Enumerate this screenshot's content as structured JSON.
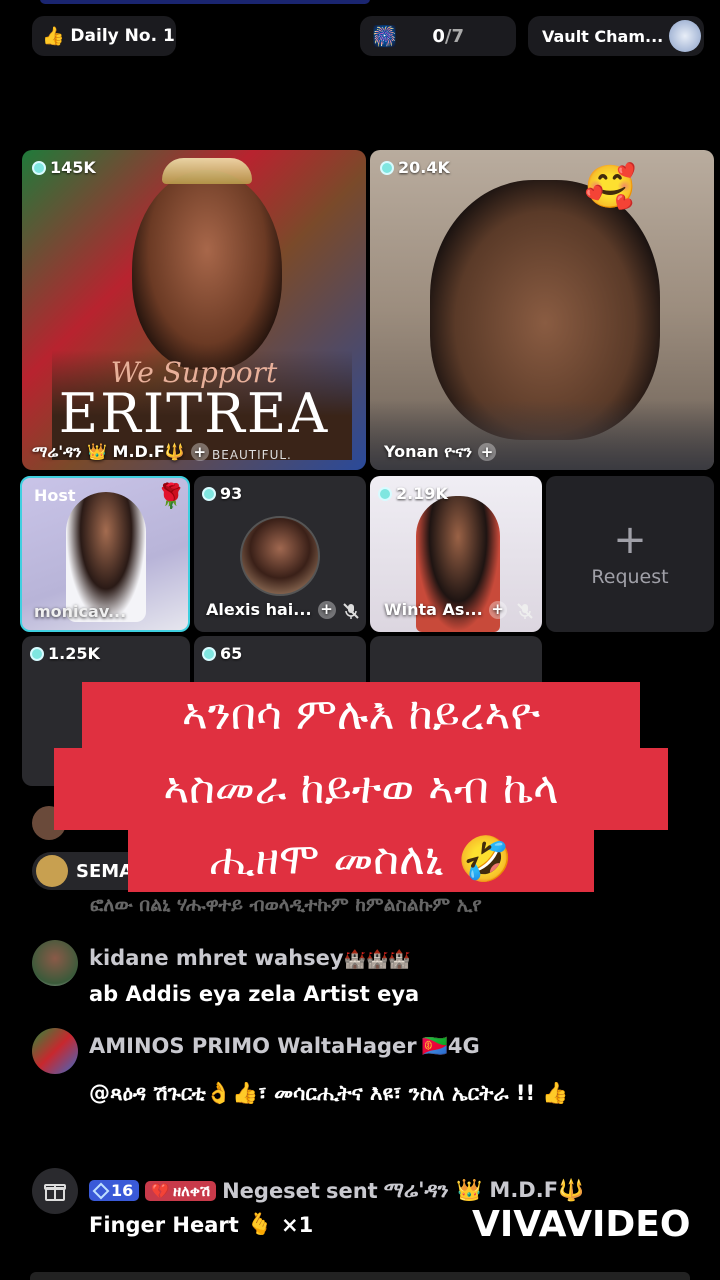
{
  "header": {
    "daily_label": "Daily No. 1",
    "daily_icon": "thumbs-up-icon",
    "counter_current": "0",
    "counter_total": "/7",
    "vault_label": "Vault Cham...",
    "vault_icon": "trophy-beast-icon"
  },
  "tiles": [
    {
      "coins": "145K",
      "name": "ማሬ'ዳን 👑 M.D.F🔱",
      "poster_script": "We Support",
      "poster_title": "ERITREA",
      "poster_sub": "BEAUTIFUL."
    },
    {
      "coins": "20.4K",
      "name": "Yonan ዮናን",
      "sticker": "heart-hug-emoji"
    },
    {
      "badge": "Host",
      "name": "monicav...",
      "sticker": "rose-icon"
    },
    {
      "coins": "93",
      "name": "Alexis hai..."
    },
    {
      "coins": "2.19K",
      "name": "Winta As..."
    },
    {
      "request_label": "Request"
    },
    {
      "coins": "1.25K"
    },
    {
      "coins": "65"
    }
  ],
  "overlay": {
    "line1": "ኣንበሳ ምሉእ ከይረኣዮ",
    "line2": "ኣስመራ ከይተወ ኣብ ኬላ",
    "line3": "ሒዘሞ መስለኒ 🤣"
  },
  "chat": {
    "partial_name": "SEMA",
    "partial_msg": "ፎለው በልኒ ሃሑዋተይ ብወላዲተኩም ከምልስልኩም ኢየ",
    "messages": [
      {
        "name": "kidane mhret wahsey",
        "badges": "🏰🏰🏰",
        "text": "ab Addis eya zela Artist eya"
      },
      {
        "name": "AMINOS PRIMO WaltaHager",
        "badges": "🇪🇷4G",
        "text": "@ጻዕዳ ሽጉርቲ👌👍፣ መሳርሒትና እዩ፣ ንስለ ኤርትራ !! 👍"
      }
    ],
    "gift": {
      "level": "16",
      "fan_badge": "ዘለቀሽ",
      "sender": "Negeset",
      "verb": "sent",
      "receiver": "ማሬ'ዳን 👑 M.D.F🔱",
      "gift_name": "Finger Heart",
      "gift_emoji": "🫰",
      "count": "×1"
    }
  },
  "watermark": "VIVAVIDEO"
}
